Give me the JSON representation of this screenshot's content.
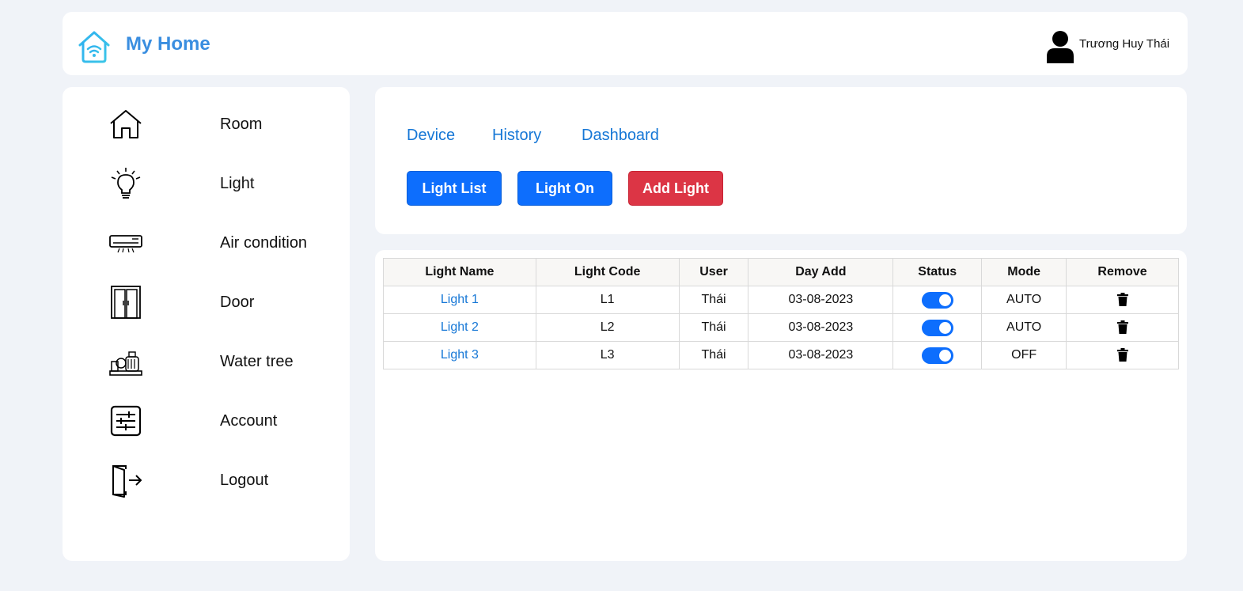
{
  "header": {
    "brand": "My Home",
    "user_name": "Trương Huy Thái",
    "logo_icon": "smart-home-wifi-icon",
    "brand_color": "#3a8ee0"
  },
  "sidebar": {
    "items": [
      {
        "label": "Room",
        "icon": "house-icon"
      },
      {
        "label": "Light",
        "icon": "lightbulb-icon"
      },
      {
        "label": "Air condition",
        "icon": "air-conditioner-icon"
      },
      {
        "label": "Door",
        "icon": "door-icon"
      },
      {
        "label": "Water tree",
        "icon": "water-pump-icon"
      },
      {
        "label": "Account",
        "icon": "settings-sliders-icon"
      },
      {
        "label": "Logout",
        "icon": "logout-icon"
      }
    ]
  },
  "tabs": [
    "Device",
    "History",
    "Dashboard"
  ],
  "buttons": {
    "light_list": "Light List",
    "light_on": "Light On",
    "add_light": "Add Light"
  },
  "table": {
    "headers": [
      "Light Name",
      "Light Code",
      "User",
      "Day Add",
      "Status",
      "Mode",
      "Remove"
    ],
    "rows": [
      {
        "name": "Light 1",
        "code": "L1",
        "user": "Thái",
        "day": "03-08-2023",
        "status": true,
        "mode": "AUTO"
      },
      {
        "name": "Light 2",
        "code": "L2",
        "user": "Thái",
        "day": "03-08-2023",
        "status": true,
        "mode": "AUTO"
      },
      {
        "name": "Light 3",
        "code": "L3",
        "user": "Thái",
        "day": "03-08-2023",
        "status": true,
        "mode": "OFF"
      }
    ]
  },
  "colors": {
    "primary": "#0d6efd",
    "danger": "#dc3545",
    "link": "#1677d6",
    "background": "#f0f3f8"
  }
}
